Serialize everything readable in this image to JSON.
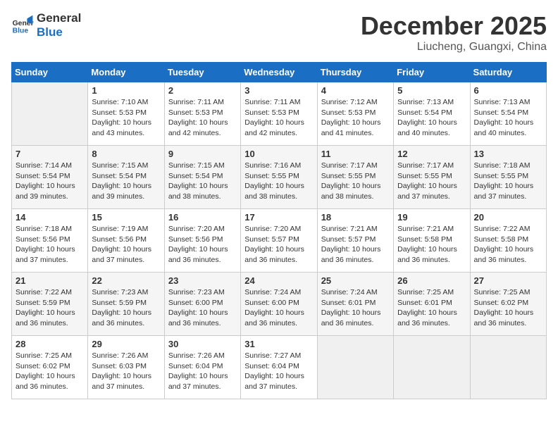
{
  "logo": {
    "line1": "General",
    "line2": "Blue"
  },
  "title": "December 2025",
  "subtitle": "Liucheng, Guangxi, China",
  "days_of_week": [
    "Sunday",
    "Monday",
    "Tuesday",
    "Wednesday",
    "Thursday",
    "Friday",
    "Saturday"
  ],
  "weeks": [
    [
      {
        "day": "",
        "empty": true
      },
      {
        "day": "1",
        "sunrise": "Sunrise: 7:10 AM",
        "sunset": "Sunset: 5:53 PM",
        "daylight": "Daylight: 10 hours and 43 minutes."
      },
      {
        "day": "2",
        "sunrise": "Sunrise: 7:11 AM",
        "sunset": "Sunset: 5:53 PM",
        "daylight": "Daylight: 10 hours and 42 minutes."
      },
      {
        "day": "3",
        "sunrise": "Sunrise: 7:11 AM",
        "sunset": "Sunset: 5:53 PM",
        "daylight": "Daylight: 10 hours and 42 minutes."
      },
      {
        "day": "4",
        "sunrise": "Sunrise: 7:12 AM",
        "sunset": "Sunset: 5:53 PM",
        "daylight": "Daylight: 10 hours and 41 minutes."
      },
      {
        "day": "5",
        "sunrise": "Sunrise: 7:13 AM",
        "sunset": "Sunset: 5:54 PM",
        "daylight": "Daylight: 10 hours and 40 minutes."
      },
      {
        "day": "6",
        "sunrise": "Sunrise: 7:13 AM",
        "sunset": "Sunset: 5:54 PM",
        "daylight": "Daylight: 10 hours and 40 minutes."
      }
    ],
    [
      {
        "day": "7",
        "sunrise": "Sunrise: 7:14 AM",
        "sunset": "Sunset: 5:54 PM",
        "daylight": "Daylight: 10 hours and 39 minutes."
      },
      {
        "day": "8",
        "sunrise": "Sunrise: 7:15 AM",
        "sunset": "Sunset: 5:54 PM",
        "daylight": "Daylight: 10 hours and 39 minutes."
      },
      {
        "day": "9",
        "sunrise": "Sunrise: 7:15 AM",
        "sunset": "Sunset: 5:54 PM",
        "daylight": "Daylight: 10 hours and 38 minutes."
      },
      {
        "day": "10",
        "sunrise": "Sunrise: 7:16 AM",
        "sunset": "Sunset: 5:55 PM",
        "daylight": "Daylight: 10 hours and 38 minutes."
      },
      {
        "day": "11",
        "sunrise": "Sunrise: 7:17 AM",
        "sunset": "Sunset: 5:55 PM",
        "daylight": "Daylight: 10 hours and 38 minutes."
      },
      {
        "day": "12",
        "sunrise": "Sunrise: 7:17 AM",
        "sunset": "Sunset: 5:55 PM",
        "daylight": "Daylight: 10 hours and 37 minutes."
      },
      {
        "day": "13",
        "sunrise": "Sunrise: 7:18 AM",
        "sunset": "Sunset: 5:55 PM",
        "daylight": "Daylight: 10 hours and 37 minutes."
      }
    ],
    [
      {
        "day": "14",
        "sunrise": "Sunrise: 7:18 AM",
        "sunset": "Sunset: 5:56 PM",
        "daylight": "Daylight: 10 hours and 37 minutes."
      },
      {
        "day": "15",
        "sunrise": "Sunrise: 7:19 AM",
        "sunset": "Sunset: 5:56 PM",
        "daylight": "Daylight: 10 hours and 37 minutes."
      },
      {
        "day": "16",
        "sunrise": "Sunrise: 7:20 AM",
        "sunset": "Sunset: 5:56 PM",
        "daylight": "Daylight: 10 hours and 36 minutes."
      },
      {
        "day": "17",
        "sunrise": "Sunrise: 7:20 AM",
        "sunset": "Sunset: 5:57 PM",
        "daylight": "Daylight: 10 hours and 36 minutes."
      },
      {
        "day": "18",
        "sunrise": "Sunrise: 7:21 AM",
        "sunset": "Sunset: 5:57 PM",
        "daylight": "Daylight: 10 hours and 36 minutes."
      },
      {
        "day": "19",
        "sunrise": "Sunrise: 7:21 AM",
        "sunset": "Sunset: 5:58 PM",
        "daylight": "Daylight: 10 hours and 36 minutes."
      },
      {
        "day": "20",
        "sunrise": "Sunrise: 7:22 AM",
        "sunset": "Sunset: 5:58 PM",
        "daylight": "Daylight: 10 hours and 36 minutes."
      }
    ],
    [
      {
        "day": "21",
        "sunrise": "Sunrise: 7:22 AM",
        "sunset": "Sunset: 5:59 PM",
        "daylight": "Daylight: 10 hours and 36 minutes."
      },
      {
        "day": "22",
        "sunrise": "Sunrise: 7:23 AM",
        "sunset": "Sunset: 5:59 PM",
        "daylight": "Daylight: 10 hours and 36 minutes."
      },
      {
        "day": "23",
        "sunrise": "Sunrise: 7:23 AM",
        "sunset": "Sunset: 6:00 PM",
        "daylight": "Daylight: 10 hours and 36 minutes."
      },
      {
        "day": "24",
        "sunrise": "Sunrise: 7:24 AM",
        "sunset": "Sunset: 6:00 PM",
        "daylight": "Daylight: 10 hours and 36 minutes."
      },
      {
        "day": "25",
        "sunrise": "Sunrise: 7:24 AM",
        "sunset": "Sunset: 6:01 PM",
        "daylight": "Daylight: 10 hours and 36 minutes."
      },
      {
        "day": "26",
        "sunrise": "Sunrise: 7:25 AM",
        "sunset": "Sunset: 6:01 PM",
        "daylight": "Daylight: 10 hours and 36 minutes."
      },
      {
        "day": "27",
        "sunrise": "Sunrise: 7:25 AM",
        "sunset": "Sunset: 6:02 PM",
        "daylight": "Daylight: 10 hours and 36 minutes."
      }
    ],
    [
      {
        "day": "28",
        "sunrise": "Sunrise: 7:25 AM",
        "sunset": "Sunset: 6:02 PM",
        "daylight": "Daylight: 10 hours and 36 minutes."
      },
      {
        "day": "29",
        "sunrise": "Sunrise: 7:26 AM",
        "sunset": "Sunset: 6:03 PM",
        "daylight": "Daylight: 10 hours and 37 minutes."
      },
      {
        "day": "30",
        "sunrise": "Sunrise: 7:26 AM",
        "sunset": "Sunset: 6:04 PM",
        "daylight": "Daylight: 10 hours and 37 minutes."
      },
      {
        "day": "31",
        "sunrise": "Sunrise: 7:27 AM",
        "sunset": "Sunset: 6:04 PM",
        "daylight": "Daylight: 10 hours and 37 minutes."
      },
      {
        "day": "",
        "empty": true
      },
      {
        "day": "",
        "empty": true
      },
      {
        "day": "",
        "empty": true
      }
    ]
  ]
}
